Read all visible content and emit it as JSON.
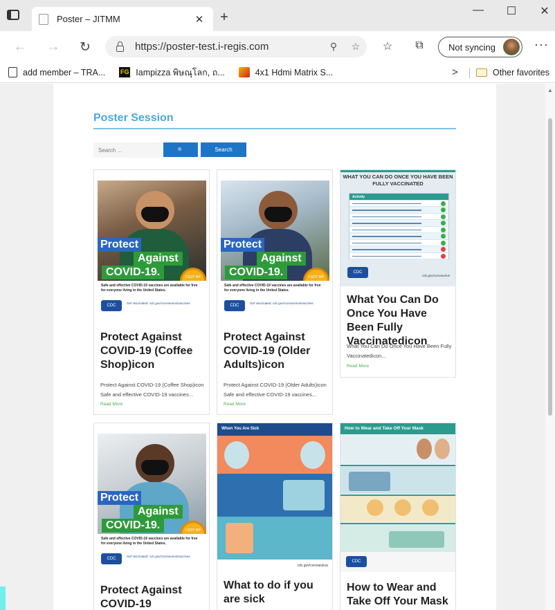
{
  "browser": {
    "tab_title": "Poster – JITMM",
    "tab_close": "✕",
    "new_tab": "+",
    "window_controls": {
      "minimize": "—",
      "maximize": "☐",
      "close": "✕"
    },
    "nav": {
      "back": "←",
      "forward": "→",
      "refresh": "↻"
    },
    "url": "https://poster-test.i-regis.com",
    "sync_label": "Not syncing",
    "more": "···",
    "favorites": [
      {
        "label": "add member – TRA...",
        "icon": "page-icon"
      },
      {
        "label": "Iampizza พิษณุโลก, ถ...",
        "icon": "fg-icon"
      },
      {
        "label": "4x1 Hdmi Matrix S...",
        "icon": "hdmi-icon"
      }
    ],
    "favorites_overflow": ">",
    "other_favorites": "Other favorites"
  },
  "page": {
    "title": "Poster Session",
    "search": {
      "placeholder": "Search ...",
      "icon_button": "🔍",
      "button_label": "Search"
    },
    "posters": [
      {
        "title": "Protect Against COVID-19 (Coffee Shop)icon",
        "excerpt": "Protect Against COVID-19 (Coffee Shop)icon Safe and effective COVID-19 vaccines...",
        "read_more": "Read More",
        "image": {
          "protect": "Protect",
          "against": "Against",
          "covid": "COVID-19.",
          "tagline": "Safe and effective COVID-19 vaccines are available for free for everyone living in the United States.",
          "cdc": "CDC",
          "cta": "Get Vaccinated: cdc.gov/coronavirus/vaccines",
          "badge": "I GOT MY COVID-19 VACCINE!"
        }
      },
      {
        "title": "Protect Against COVID-19 (Older Adults)icon",
        "excerpt": "Protect Against COVID-19 (Older Adults)icon Safe and effective COVID-19 vaccines...",
        "read_more": "Read More",
        "image": {
          "protect": "Protect",
          "against": "Against",
          "covid": "COVID-19.",
          "tagline": "Safe and effective COVID-19 vaccines are available for free for everyone living in the United States.",
          "cdc": "CDC",
          "cta": "Get Vaccinated: cdc.gov/coronavirus/vaccines",
          "badge": "I GOT MY COVID-19 VACCINE!"
        }
      },
      {
        "title": "What You Can Do Once You Have Been Fully Vaccinatedicon",
        "excerpt": "What You Can Do Once You Have Been Fully Vaccinatedicon...",
        "read_more": "Read More",
        "image": {
          "heading": "WHAT YOU CAN DO ONCE YOU HAVE BEEN FULLY VACCINATED",
          "table_header": "Activity",
          "cdc": "CDC",
          "site": "cdc.gov/coronavirus"
        }
      },
      {
        "title": "Protect Against COVID-19",
        "excerpt": "",
        "read_more": "",
        "image": {
          "protect": "Protect",
          "against": "Against",
          "covid": "COVID-19.",
          "tagline": "Safe and effective COVID-19 vaccines are available for free for everyone living in the United States.",
          "cdc": "CDC",
          "cta": "Get Vaccinated: cdc.gov/coronavirus/vaccines",
          "badge": "I GOT MY COVID-19 VACCINE!"
        }
      },
      {
        "title": "What to do if you are sick",
        "excerpt": "",
        "read_more": "",
        "image": {
          "heading": "When You Are Sick",
          "site": "cdc.gov/coronavirus"
        }
      },
      {
        "title": "How to Wear and Take Off Your Mask",
        "excerpt": "",
        "read_more": "",
        "image": {
          "heading": "How to Wear and Take Off Your Mask",
          "cdc": "CDC"
        }
      }
    ]
  },
  "colors": {
    "accent": "#4aa7dc",
    "button": "#1e74c6",
    "green": "#2e9b3a",
    "read_more": "#4caf50"
  }
}
